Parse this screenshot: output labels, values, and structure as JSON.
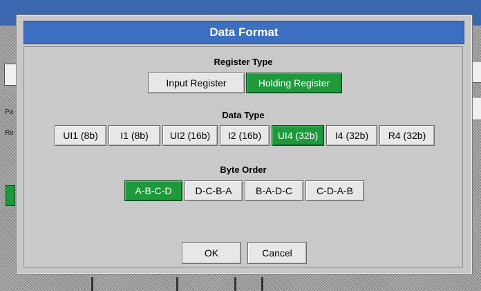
{
  "window": {
    "title": "Data Format"
  },
  "register_type": {
    "label": "Register Type",
    "options": [
      "Input Register",
      "Holding Register"
    ],
    "selected": "Holding Register"
  },
  "data_type": {
    "label": "Data Type",
    "options": [
      "UI1 (8b)",
      "I1 (8b)",
      "UI2 (16b)",
      "I2 (16b)",
      "UI4 (32b)",
      "I4 (32b)",
      "R4 (32b)"
    ],
    "selected": "UI4 (32b)"
  },
  "byte_order": {
    "label": "Byte Order",
    "options": [
      "A-B-C-D",
      "D-C-B-A",
      "B-A-D-C",
      "C-D-A-B"
    ],
    "selected": "A-B-C-D"
  },
  "actions": {
    "ok_label": "OK",
    "cancel_label": "Cancel"
  },
  "background": {
    "fragment_labels": [
      "Pa",
      "Re"
    ]
  },
  "colors": {
    "title_bar": "#3d6fc0",
    "selected": "#1e9a3c",
    "dialog_bg": "#c8c8c8"
  }
}
